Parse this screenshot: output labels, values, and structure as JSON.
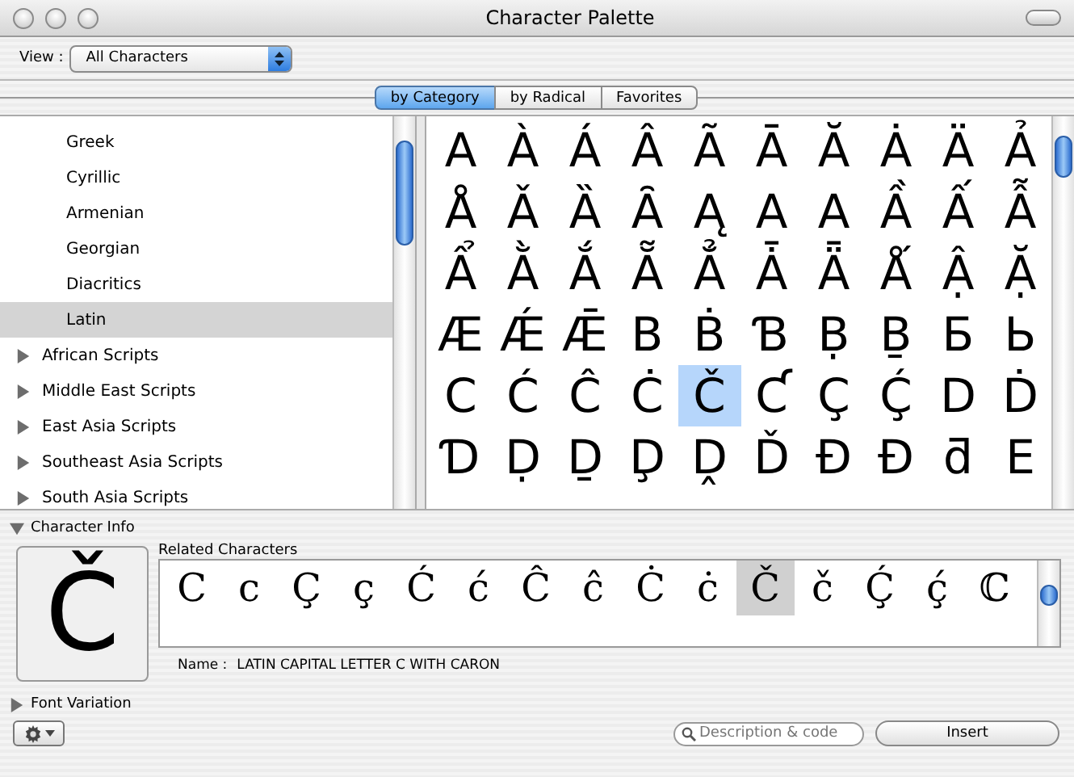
{
  "window": {
    "title": "Character Palette"
  },
  "view": {
    "label": "View :",
    "value": "All Characters"
  },
  "tabs": [
    {
      "label": "by Category",
      "selected": true
    },
    {
      "label": "by Radical",
      "selected": false
    },
    {
      "label": "Favorites",
      "selected": false
    }
  ],
  "categories": [
    {
      "kind": "leaf",
      "label": "Greek",
      "selected": false
    },
    {
      "kind": "leaf",
      "label": "Cyrillic",
      "selected": false
    },
    {
      "kind": "leaf",
      "label": "Armenian",
      "selected": false
    },
    {
      "kind": "leaf",
      "label": "Georgian",
      "selected": false
    },
    {
      "kind": "leaf",
      "label": "Diacritics",
      "selected": false
    },
    {
      "kind": "leaf",
      "label": "Latin",
      "selected": true
    },
    {
      "kind": "group",
      "label": "African Scripts",
      "expanded": false
    },
    {
      "kind": "group",
      "label": "Middle East Scripts",
      "expanded": false
    },
    {
      "kind": "group",
      "label": "East Asia Scripts",
      "expanded": false
    },
    {
      "kind": "group",
      "label": "Southeast Asia Scripts",
      "expanded": false
    },
    {
      "kind": "group",
      "label": "South Asia Scripts",
      "expanded": false
    }
  ],
  "characters": [
    {
      "char": "A",
      "selected": false
    },
    {
      "char": "À",
      "selected": false
    },
    {
      "char": "Á",
      "selected": false
    },
    {
      "char": "Â",
      "selected": false
    },
    {
      "char": "Ã",
      "selected": false
    },
    {
      "char": "Ā",
      "selected": false
    },
    {
      "char": "Ă",
      "selected": false
    },
    {
      "char": "Ȧ",
      "selected": false
    },
    {
      "char": "Ä",
      "selected": false
    },
    {
      "char": "Ả",
      "selected": false
    },
    {
      "char": "Å",
      "selected": false
    },
    {
      "char": "Ǎ",
      "selected": false
    },
    {
      "char": "Ȁ",
      "selected": false
    },
    {
      "char": "Ȃ",
      "selected": false
    },
    {
      "char": "Ą",
      "selected": false
    },
    {
      "char": "A",
      "selected": false
    },
    {
      "char": "A",
      "selected": false
    },
    {
      "char": "Ầ",
      "selected": false
    },
    {
      "char": "Ấ",
      "selected": false
    },
    {
      "char": "Ẫ",
      "selected": false
    },
    {
      "char": "Ẩ",
      "selected": false
    },
    {
      "char": "Ằ",
      "selected": false
    },
    {
      "char": "Ắ",
      "selected": false
    },
    {
      "char": "Ẵ",
      "selected": false
    },
    {
      "char": "Ẳ",
      "selected": false
    },
    {
      "char": "Ǡ",
      "selected": false
    },
    {
      "char": "Ǟ",
      "selected": false
    },
    {
      "char": "Ǻ",
      "selected": false
    },
    {
      "char": "Ậ",
      "selected": false
    },
    {
      "char": "Ặ",
      "selected": false
    },
    {
      "char": "Æ",
      "selected": false
    },
    {
      "char": "Ǽ",
      "selected": false
    },
    {
      "char": "Ǣ",
      "selected": false
    },
    {
      "char": "B",
      "selected": false
    },
    {
      "char": "Ḃ",
      "selected": false
    },
    {
      "char": "Ɓ",
      "selected": false
    },
    {
      "char": "Ḅ",
      "selected": false
    },
    {
      "char": "Ḇ",
      "selected": false
    },
    {
      "char": "Б",
      "selected": false
    },
    {
      "char": "Ь",
      "selected": false
    },
    {
      "char": "C",
      "selected": false
    },
    {
      "char": "Ć",
      "selected": false
    },
    {
      "char": "Ĉ",
      "selected": false
    },
    {
      "char": "Ċ",
      "selected": false
    },
    {
      "char": "Č",
      "selected": true
    },
    {
      "char": "Ƈ",
      "selected": false
    },
    {
      "char": "Ç",
      "selected": false
    },
    {
      "char": "Ḉ",
      "selected": false
    },
    {
      "char": "D",
      "selected": false
    },
    {
      "char": "Ḋ",
      "selected": false
    },
    {
      "char": "Ɗ",
      "selected": false
    },
    {
      "char": "Ḍ",
      "selected": false
    },
    {
      "char": "Ḏ",
      "selected": false
    },
    {
      "char": "Ḑ",
      "selected": false
    },
    {
      "char": "Ḓ",
      "selected": false
    },
    {
      "char": "Ď",
      "selected": false
    },
    {
      "char": "Đ",
      "selected": false
    },
    {
      "char": "Ð",
      "selected": false
    },
    {
      "char": "ƌ",
      "selected": false
    },
    {
      "char": "E",
      "selected": false
    }
  ],
  "character_info": {
    "label": "Character Info",
    "expanded": true,
    "preview": "Č",
    "related_label": "Related Characters",
    "related": [
      {
        "char": "C",
        "selected": false
      },
      {
        "char": "c",
        "selected": false
      },
      {
        "char": "Ç",
        "selected": false
      },
      {
        "char": "ç",
        "selected": false
      },
      {
        "char": "Ć",
        "selected": false
      },
      {
        "char": "ć",
        "selected": false
      },
      {
        "char": "Ĉ",
        "selected": false
      },
      {
        "char": "ĉ",
        "selected": false
      },
      {
        "char": "Ċ",
        "selected": false
      },
      {
        "char": "ċ",
        "selected": false
      },
      {
        "char": "Č",
        "selected": true
      },
      {
        "char": "č",
        "selected": false
      },
      {
        "char": "Ḉ",
        "selected": false
      },
      {
        "char": "ḉ",
        "selected": false
      },
      {
        "char": "ℂ",
        "selected": false
      }
    ],
    "name_label": "Name :",
    "name": "LATIN CAPITAL LETTER C WITH CARON"
  },
  "font_variation": {
    "label": "Font Variation",
    "expanded": false
  },
  "search": {
    "placeholder": "Description & code"
  },
  "insert_button": "Insert"
}
